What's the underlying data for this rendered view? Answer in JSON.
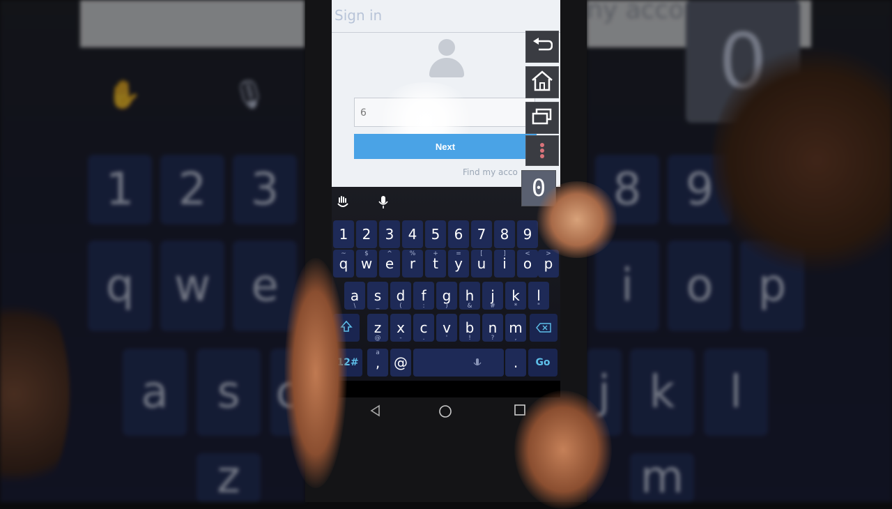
{
  "webpage": {
    "title": "Sign in",
    "field_value": "6",
    "next_label": "Next",
    "find_link": "Find my acco"
  },
  "keyboard": {
    "number_row": [
      "1",
      "2",
      "3",
      "4",
      "5",
      "6",
      "7",
      "8",
      "9"
    ],
    "row1": [
      {
        "k": "q",
        "s": "~"
      },
      {
        "k": "w",
        "s": "$"
      },
      {
        "k": "e",
        "s": "^"
      },
      {
        "k": "r",
        "s": "%"
      },
      {
        "k": "t",
        "s": "+"
      },
      {
        "k": "y",
        "s": "="
      },
      {
        "k": "u",
        "s": "["
      },
      {
        "k": "i",
        "s": "]"
      },
      {
        "k": "o",
        "s": "<"
      },
      {
        "k": "p",
        "s": ">"
      }
    ],
    "row2": [
      {
        "k": "a",
        "s": "\\"
      },
      {
        "k": "s",
        "s": "_"
      },
      {
        "k": "d",
        "s": "("
      },
      {
        "k": "f",
        "s": ":"
      },
      {
        "k": "g",
        "s": ")"
      },
      {
        "k": "h",
        "s": "&"
      },
      {
        "k": "j",
        "s": "#"
      },
      {
        "k": "k",
        "s": "*"
      },
      {
        "k": "l",
        "s": "\""
      }
    ],
    "row3": [
      {
        "k": "z",
        "s": "@"
      },
      {
        "k": "x",
        "s": "-"
      },
      {
        "k": "c",
        "s": "."
      },
      {
        "k": "v",
        "s": "'"
      },
      {
        "k": "b",
        "s": "!"
      },
      {
        "k": "n",
        "s": "?"
      },
      {
        "k": "m",
        "s": ","
      }
    ],
    "mode_label": "12#",
    "comma_label": ",",
    "comma_sup": "a",
    "at_label": "@",
    "period_label": ".",
    "go_label": "Go"
  },
  "float_buttons": {
    "zero_label": "0"
  },
  "background": {
    "right_zero": "0",
    "right_keys": [
      "8",
      "9",
      "i",
      "o",
      "p",
      "k",
      "l",
      "j",
      "m"
    ],
    "left_keys": [
      "1",
      "2",
      "3",
      "q",
      "w",
      "e",
      "a",
      "s",
      "c",
      "z"
    ],
    "topbar_text": "ny acco"
  },
  "icons": {
    "back": "back-arrow-icon",
    "home": "home-icon",
    "recents": "recents-icon",
    "menu": "more-menu-icon",
    "emoji": "emoji-hand-icon",
    "mic": "microphone-icon",
    "shift": "shift-icon",
    "backspace": "backspace-icon",
    "nav_back": "nav-back-icon",
    "nav_home": "nav-home-icon",
    "nav_recents": "nav-recents-icon"
  },
  "colors": {
    "key_bg": "#1e2a57",
    "accent": "#5ec0ea",
    "next_button": "#4aa3e6"
  }
}
